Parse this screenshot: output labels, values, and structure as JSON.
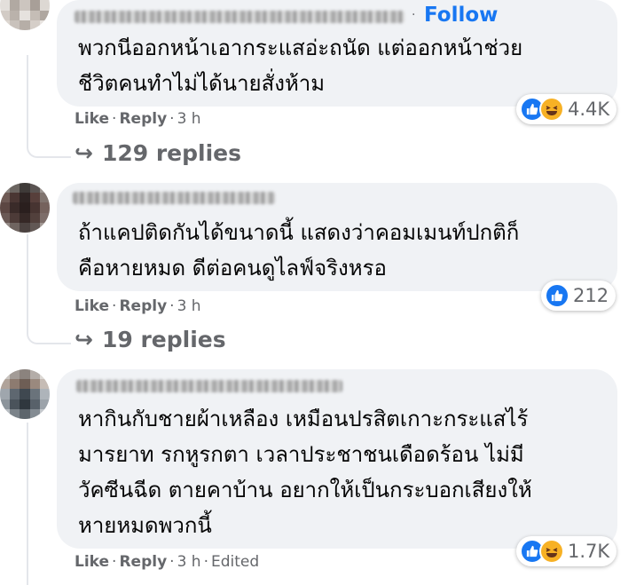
{
  "comments": [
    {
      "follow_label": "Follow",
      "text": "พวกนีออกหน้าเอากระแสอ่ะถนัด แต่ออกหน้าช่วย\nชีวิตคนทำไม่ได้นายสั่งห้าม",
      "reaction_count": "4.4K",
      "reaction_icons": [
        "like-icon",
        "haha-icon"
      ],
      "like_label": "Like",
      "reply_label": "Reply",
      "time": "3 h",
      "edited_label": "",
      "replies_label": "129 replies"
    },
    {
      "text": "ถ้าแคปติดกันได้ขนาดนี้ แสดงว่าคอมเมนท์ปกติก็\nคือหายหมด ดีต่อคนดูไลฟ์จริงหรอ",
      "reaction_count": "212",
      "reaction_icons": [
        "like-icon"
      ],
      "like_label": "Like",
      "reply_label": "Reply",
      "time": "3 h",
      "edited_label": "",
      "replies_label": "19 replies"
    },
    {
      "text": "หากินกับชายผ้าเหลือง เหมือนปรสิตเกาะกระแสไร้\nมารยาท รกหูรกตา เวลาประชาชนเดือดร้อน ไม่มี\nวัคซีนฉีด ตายคาบ้าน อยากให้เป็นกระบอกเสียงให้\nหายหมดพวกนี้",
      "reaction_count": "1.7K",
      "reaction_icons": [
        "like-icon",
        "haha-icon"
      ],
      "like_label": "Like",
      "reply_label": "Reply",
      "time": "3 h",
      "edited_label": "Edited"
    }
  ],
  "colors": {
    "bubble": "#f0f2f5",
    "accent": "#1877f2",
    "meta": "#65676b",
    "text": "#050505"
  }
}
